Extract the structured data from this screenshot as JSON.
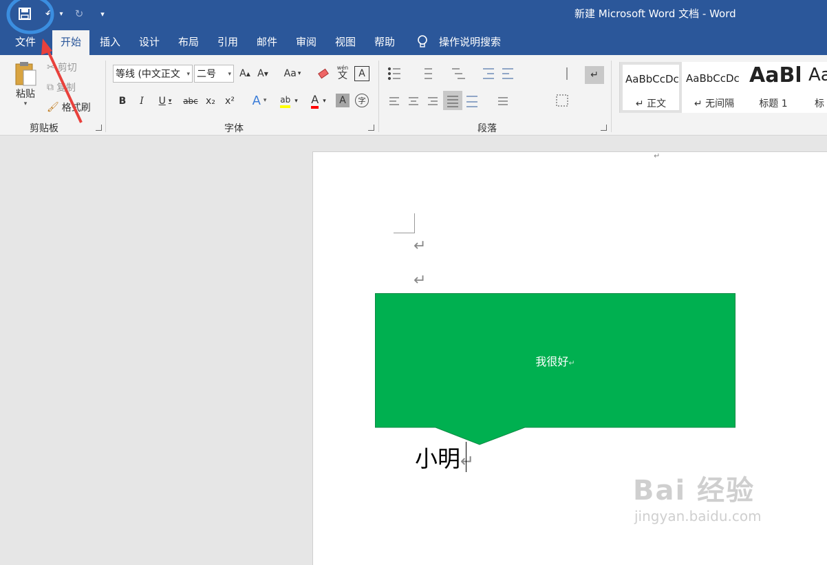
{
  "window": {
    "title": "新建 Microsoft Word 文档 - Word"
  },
  "qat": {
    "more_label": "▾"
  },
  "tabs": [
    {
      "label": "文件"
    },
    {
      "label": "开始"
    },
    {
      "label": "插入"
    },
    {
      "label": "设计"
    },
    {
      "label": "布局"
    },
    {
      "label": "引用"
    },
    {
      "label": "邮件"
    },
    {
      "label": "审阅"
    },
    {
      "label": "视图"
    },
    {
      "label": "帮助"
    }
  ],
  "tell_me": {
    "label": "操作说明搜索"
  },
  "clipboard": {
    "group_label": "剪贴板",
    "paste": "粘贴",
    "cut": "剪切",
    "copy": "复制",
    "format_painter": "格式刷"
  },
  "font": {
    "group_label": "字体",
    "name": "等线 (中文正文",
    "size": "二号",
    "grow": "A",
    "shrink": "A",
    "case": "Aa",
    "phonetic": "wén",
    "phonetic_char": "文",
    "bold": "B",
    "italic": "I",
    "underline": "U",
    "strike": "abc",
    "sub": "x₂",
    "sup": "x²",
    "effects": "A",
    "highlight": "ab",
    "color": "A",
    "shading": "A",
    "enclose": "字"
  },
  "paragraph": {
    "group_label": "段落"
  },
  "styles": [
    {
      "preview": "AaBbCcDc",
      "name": "↵ 正文"
    },
    {
      "preview": "AaBbCcDc",
      "name": "↵ 无间隔"
    },
    {
      "preview": "AaBl",
      "name": "标题 1"
    },
    {
      "preview": "Aa",
      "name": "标"
    }
  ],
  "document": {
    "shape_text": "我很好",
    "body_text": "小明",
    "shape_fill": "#00b050",
    "para_mark": "↵"
  },
  "colors": {
    "brand": "#2b579a",
    "annotation_red": "#e8413c",
    "annotation_blue": "#3b8ee0"
  },
  "watermark": {
    "text": "Bai 经验",
    "sub": "jingyan.baidu.com"
  }
}
